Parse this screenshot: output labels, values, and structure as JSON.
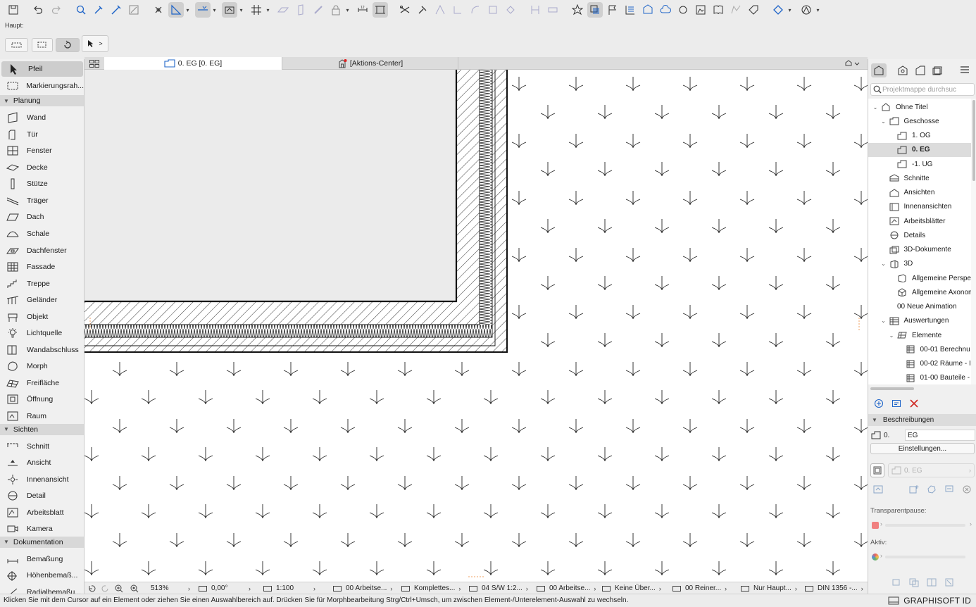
{
  "info_box": {
    "label": "Haupt:",
    "pointer_icon": "arrow-pointer-icon",
    "chevron": ">"
  },
  "tabs": [
    {
      "label": "0. EG [0. EG]",
      "icon": "floorplan-icon"
    },
    {
      "label": "[Aktions-Center]",
      "icon": "action-center-icon"
    }
  ],
  "toolbox": {
    "tools_top": [
      {
        "label": "Pfeil",
        "icon": "arrow-icon",
        "selected": true
      },
      {
        "label": "Markierungsrah...",
        "icon": "marquee-icon"
      }
    ],
    "groups": [
      {
        "label": "Planung",
        "tools": [
          {
            "label": "Wand",
            "icon": "wall-icon"
          },
          {
            "label": "Tür",
            "icon": "door-icon"
          },
          {
            "label": "Fenster",
            "icon": "window-icon"
          },
          {
            "label": "Decke",
            "icon": "slab-icon"
          },
          {
            "label": "Stütze",
            "icon": "column-icon"
          },
          {
            "label": "Träger",
            "icon": "beam-icon"
          },
          {
            "label": "Dach",
            "icon": "roof-icon"
          },
          {
            "label": "Schale",
            "icon": "shell-icon"
          },
          {
            "label": "Dachfenster",
            "icon": "skylight-icon"
          },
          {
            "label": "Fassade",
            "icon": "curtain-wall-icon"
          },
          {
            "label": "Treppe",
            "icon": "stair-icon"
          },
          {
            "label": "Geländer",
            "icon": "railing-icon"
          },
          {
            "label": "Objekt",
            "icon": "object-icon"
          },
          {
            "label": "Lichtquelle",
            "icon": "lamp-icon"
          },
          {
            "label": "Wandabschluss",
            "icon": "wall-end-icon"
          },
          {
            "label": "Morph",
            "icon": "morph-icon"
          },
          {
            "label": "Freifläche",
            "icon": "mesh-icon"
          },
          {
            "label": "Öffnung",
            "icon": "opening-icon"
          },
          {
            "label": "Raum",
            "icon": "zone-icon"
          }
        ]
      },
      {
        "label": "Sichten",
        "tools": [
          {
            "label": "Schnitt",
            "icon": "section-icon"
          },
          {
            "label": "Ansicht",
            "icon": "elevation-icon"
          },
          {
            "label": "Innenansicht",
            "icon": "interior-elevation-icon"
          },
          {
            "label": "Detail",
            "icon": "detail-icon"
          },
          {
            "label": "Arbeitsblatt",
            "icon": "worksheet-icon"
          },
          {
            "label": "Kamera",
            "icon": "camera-icon"
          }
        ]
      },
      {
        "label": "Dokumentation",
        "tools": [
          {
            "label": "Bemaßung",
            "icon": "dimension-icon"
          },
          {
            "label": "Höhenbemaß...",
            "icon": "level-dimension-icon"
          },
          {
            "label": "Radialbemaßu...",
            "icon": "radial-dimension-icon"
          }
        ]
      }
    ]
  },
  "navigator": {
    "search_placeholder": "Projektmappe durchsuc",
    "tree": [
      {
        "label": "Ohne Titel",
        "level": 0,
        "chev": "v",
        "icon": "house-icon"
      },
      {
        "label": "Geschosse",
        "level": 1,
        "chev": "v",
        "icon": "story-folder-icon"
      },
      {
        "label": "1. OG",
        "level": 2,
        "chev": "",
        "icon": "story-icon"
      },
      {
        "label": "0. EG",
        "level": 2,
        "chev": "",
        "icon": "story-icon",
        "selected": true
      },
      {
        "label": "-1. UG",
        "level": 2,
        "chev": "",
        "icon": "story-icon"
      },
      {
        "label": "Schnitte",
        "level": 1,
        "chev": "",
        "icon": "section-folder-icon"
      },
      {
        "label": "Ansichten",
        "level": 1,
        "chev": "",
        "icon": "elevation-folder-icon"
      },
      {
        "label": "Innenansichten",
        "level": 1,
        "chev": "",
        "icon": "ie-folder-icon"
      },
      {
        "label": "Arbeitsblätter",
        "level": 1,
        "chev": "",
        "icon": "worksheet-folder-icon"
      },
      {
        "label": "Details",
        "level": 1,
        "chev": "",
        "icon": "detail-folder-icon"
      },
      {
        "label": "3D-Dokumente",
        "level": 1,
        "chev": "",
        "icon": "3d-document-icon"
      },
      {
        "label": "3D",
        "level": 1,
        "chev": "v",
        "icon": "3d-folder-icon"
      },
      {
        "label": "Allgemeine Perspek",
        "level": 2,
        "chev": "",
        "icon": "perspective-icon"
      },
      {
        "label": "Allgemeine Axonom",
        "level": 2,
        "chev": "",
        "icon": "axonometry-icon"
      },
      {
        "label": "00 Neue Animation",
        "level": 2,
        "chev": "",
        "icon": "animation-icon"
      },
      {
        "label": "Auswertungen",
        "level": 1,
        "chev": "v",
        "icon": "schedule-folder-icon"
      },
      {
        "label": "Elemente",
        "level": 2,
        "chev": "v",
        "icon": "schedule-group-icon"
      },
      {
        "label": "00-01 Berechnu",
        "level": 3,
        "chev": "",
        "icon": "schedule-icon"
      },
      {
        "label": "00-02 Räume - I",
        "level": 3,
        "chev": "",
        "icon": "schedule-icon"
      },
      {
        "label": "01-00 Bauteile -",
        "level": 3,
        "chev": "",
        "icon": "schedule-icon"
      }
    ],
    "descriptions_label": "Beschreibungen",
    "story_number": "0.",
    "story_name": "EG",
    "settings_label": "Einstellungen...",
    "view_label": "0. EG",
    "transparent_label": "Transparentpause:",
    "active_label": "Aktiv:"
  },
  "quick_options": [
    {
      "text": "513%",
      "icon": "zoom-icon"
    },
    {
      "text": "0,00°",
      "icon": "orientation-icon"
    },
    {
      "text": "1:100",
      "icon": "scale-icon"
    },
    {
      "text": "00 Arbeitse...",
      "icon": "layer-icon"
    },
    {
      "text": "Komplettes...",
      "icon": "structure-icon"
    },
    {
      "text": "04 S/W 1:2...",
      "icon": "pen-set-icon"
    },
    {
      "text": "00 Arbeitse...",
      "icon": "model-view-icon"
    },
    {
      "text": "Keine Über...",
      "icon": "override-icon"
    },
    {
      "text": "00 Reiner...",
      "icon": "renovation-icon"
    },
    {
      "text": "Nur Haupt...",
      "icon": "partial-structure-icon"
    },
    {
      "text": "DIN 1356 -...",
      "icon": "dimension-standard-icon"
    }
  ],
  "status": {
    "text": "Klicken Sie mit dem Cursor auf ein Element oder ziehen Sie einen Auswahlbereich auf. Drücken Sie für Morphbearbeitung Strg/Ctrl+Umsch, um zwischen Element-/Unterelement-Auswahl zu wechseln.",
    "brand": "GRAPHISOFT ID"
  },
  "colors": {
    "accent": "#1e64c8",
    "delete": "#d0302a",
    "drawing": "#111111"
  }
}
